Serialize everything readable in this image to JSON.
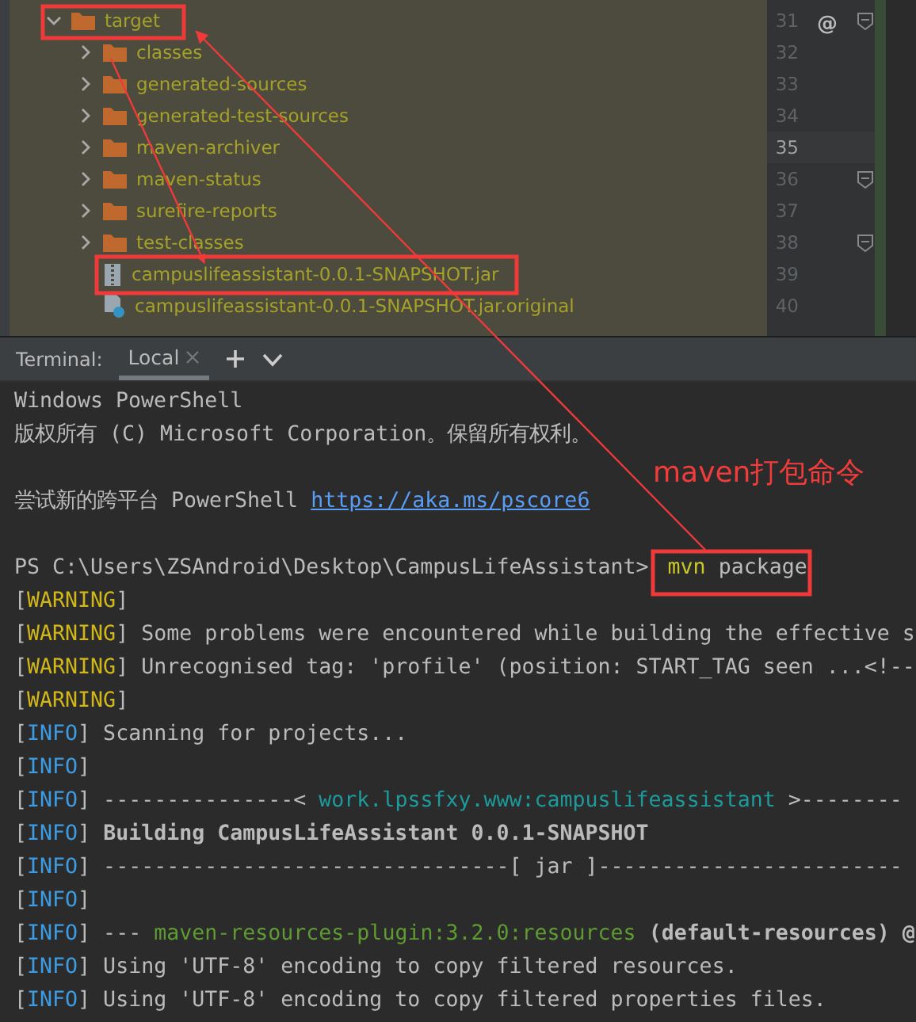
{
  "project_tree": {
    "name": "target",
    "kind": "folder",
    "expanded": true,
    "children": [
      {
        "name": "classes",
        "kind": "folder",
        "expanded": false
      },
      {
        "name": "generated-sources",
        "kind": "folder",
        "expanded": false
      },
      {
        "name": "generated-test-sources",
        "kind": "folder",
        "expanded": false
      },
      {
        "name": "maven-archiver",
        "kind": "folder",
        "expanded": false
      },
      {
        "name": "maven-status",
        "kind": "folder",
        "expanded": false
      },
      {
        "name": "surefire-reports",
        "kind": "folder",
        "expanded": false
      },
      {
        "name": "test-classes",
        "kind": "folder",
        "expanded": false
      },
      {
        "name": "campuslifeassistant-0.0.1-SNAPSHOT.jar",
        "kind": "jar"
      },
      {
        "name": "campuslifeassistant-0.0.1-SNAPSHOT.jar.original",
        "kind": "unknown"
      }
    ]
  },
  "gutter": {
    "marker": "@",
    "lines": [
      {
        "number": "31",
        "selected": false,
        "fold": true
      },
      {
        "number": "32",
        "selected": false,
        "fold": false
      },
      {
        "number": "33",
        "selected": false,
        "fold": false
      },
      {
        "number": "34",
        "selected": false,
        "fold": false
      },
      {
        "number": "35",
        "selected": true,
        "fold": false
      },
      {
        "number": "36",
        "selected": false,
        "fold": true
      },
      {
        "number": "37",
        "selected": false,
        "fold": false
      },
      {
        "number": "38",
        "selected": false,
        "fold": true
      },
      {
        "number": "39",
        "selected": false,
        "fold": false
      },
      {
        "number": "40",
        "selected": false,
        "fold": false
      }
    ]
  },
  "terminal": {
    "title": "Terminal:",
    "tabs": [
      {
        "label": "Local",
        "selected": true
      }
    ],
    "lines": [
      {
        "kind": "output",
        "segments": [
          {
            "text": "Windows PowerShell",
            "kind": "plain"
          }
        ]
      },
      {
        "kind": "output",
        "segments": [
          {
            "text": "版权所有 (C) Microsoft Corporation。保留所有权利。",
            "kind": "plain"
          }
        ]
      },
      {
        "kind": "blank"
      },
      {
        "kind": "output",
        "segments": [
          {
            "text": "尝试新的跨平台 PowerShell ",
            "kind": "plain"
          },
          {
            "text": "https://aka.ms/pscore6",
            "kind": "link"
          }
        ]
      },
      {
        "kind": "blank"
      },
      {
        "kind": "prompt",
        "prompt": "PS C:\\Users\\ZSAndroid\\Desktop\\CampusLifeAssistant>",
        "program": "mvn",
        "args": "package"
      },
      {
        "kind": "output",
        "segments": [
          {
            "text": "[",
            "kind": "plain"
          },
          {
            "text": "WARNING",
            "kind": "warning"
          },
          {
            "text": "]",
            "kind": "plain"
          }
        ]
      },
      {
        "kind": "output",
        "segments": [
          {
            "text": "[",
            "kind": "plain"
          },
          {
            "text": "WARNING",
            "kind": "warning"
          },
          {
            "text": "] Some problems were encountered while building the effective s",
            "kind": "plain"
          }
        ]
      },
      {
        "kind": "output",
        "segments": [
          {
            "text": "[",
            "kind": "plain"
          },
          {
            "text": "WARNING",
            "kind": "warning"
          },
          {
            "text": "] Unrecognised tag: 'profile' (position: START_TAG seen ...<!--",
            "kind": "plain"
          }
        ]
      },
      {
        "kind": "output",
        "segments": [
          {
            "text": "[",
            "kind": "plain"
          },
          {
            "text": "WARNING",
            "kind": "warning"
          },
          {
            "text": "]",
            "kind": "plain"
          }
        ]
      },
      {
        "kind": "output",
        "segments": [
          {
            "text": "[",
            "kind": "plain"
          },
          {
            "text": "INFO",
            "kind": "info"
          },
          {
            "text": "] Scanning for projects...",
            "kind": "plain"
          }
        ]
      },
      {
        "kind": "output",
        "segments": [
          {
            "text": "[",
            "kind": "plain"
          },
          {
            "text": "INFO",
            "kind": "info"
          },
          {
            "text": "]",
            "kind": "plain"
          }
        ]
      },
      {
        "kind": "output",
        "segments": [
          {
            "text": "[",
            "kind": "plain"
          },
          {
            "text": "INFO",
            "kind": "info"
          },
          {
            "text": "] ---------------< ",
            "kind": "plain"
          },
          {
            "text": "work.lpssfxy.www:campuslifeassistant",
            "kind": "cyan"
          },
          {
            "text": " >--------",
            "kind": "plain"
          }
        ]
      },
      {
        "kind": "output",
        "segments": [
          {
            "text": "[",
            "kind": "plain"
          },
          {
            "text": "INFO",
            "kind": "info"
          },
          {
            "text": "] ",
            "kind": "plain"
          },
          {
            "text": "Building CampusLifeAssistant 0.0.1-SNAPSHOT",
            "kind": "bold"
          }
        ]
      },
      {
        "kind": "output",
        "segments": [
          {
            "text": "[",
            "kind": "plain"
          },
          {
            "text": "INFO",
            "kind": "info"
          },
          {
            "text": "] --------------------------------[ jar ]------------------------",
            "kind": "plain"
          }
        ]
      },
      {
        "kind": "output",
        "segments": [
          {
            "text": "[",
            "kind": "plain"
          },
          {
            "text": "INFO",
            "kind": "info"
          },
          {
            "text": "]",
            "kind": "plain"
          }
        ]
      },
      {
        "kind": "output",
        "segments": [
          {
            "text": "[",
            "kind": "plain"
          },
          {
            "text": "INFO",
            "kind": "info"
          },
          {
            "text": "] --- ",
            "kind": "plain"
          },
          {
            "text": "maven-resources-plugin:3.2.0:resources",
            "kind": "green"
          },
          {
            "text": " (default-resources) @",
            "kind": "bold"
          }
        ]
      },
      {
        "kind": "output",
        "segments": [
          {
            "text": "[",
            "kind": "plain"
          },
          {
            "text": "INFO",
            "kind": "info"
          },
          {
            "text": "] Using 'UTF-8' encoding to copy filtered resources.",
            "kind": "plain"
          }
        ]
      },
      {
        "kind": "output",
        "segments": [
          {
            "text": "[",
            "kind": "plain"
          },
          {
            "text": "INFO",
            "kind": "info"
          },
          {
            "text": "] Using 'UTF-8' encoding to copy filtered properties files.",
            "kind": "plain"
          }
        ]
      }
    ]
  },
  "annotation": {
    "label": "maven打包命令"
  }
}
